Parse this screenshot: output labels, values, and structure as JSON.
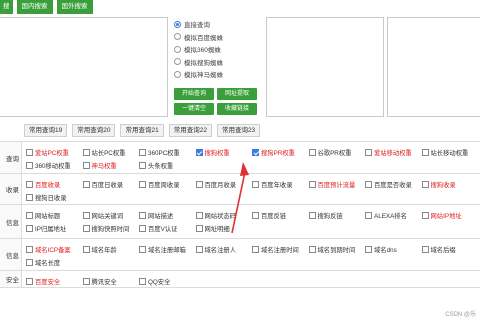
{
  "tabs": [
    "搜",
    "国内搜索",
    "国外搜索"
  ],
  "radios": [
    {
      "label": "直接查询",
      "checked": true
    },
    {
      "label": "模拟百度蜘蛛",
      "checked": false
    },
    {
      "label": "模拟360蜘蛛",
      "checked": false
    },
    {
      "label": "模拟搜狗蜘蛛",
      "checked": false
    },
    {
      "label": "模拟神马蜘蛛",
      "checked": false
    }
  ],
  "buttons": {
    "start": "开始查询",
    "extract": "网址提取",
    "clear": "一键清空",
    "export": "收藏链接"
  },
  "common_queries": [
    "常用查询19",
    "常用查询20",
    "常用查询21",
    "常用查询22",
    "常用查询23"
  ],
  "sections": [
    {
      "label": "查询",
      "items": [
        {
          "label": "爱站PC权重",
          "checked": false,
          "red": true
        },
        {
          "label": "站长PC权重",
          "checked": false,
          "red": false
        },
        {
          "label": "360PC权重",
          "checked": false,
          "red": false
        },
        {
          "label": "搜狗权重",
          "checked": true,
          "red": true
        },
        {
          "label": "搜狗PR权重",
          "checked": true,
          "red": true
        },
        {
          "label": "谷歌PR权重",
          "checked": false,
          "red": false
        },
        {
          "label": "爱站移动权重",
          "checked": false,
          "red": true
        },
        {
          "label": "站长移动权重",
          "checked": false,
          "red": false
        },
        {
          "label": "360移动权重",
          "checked": false,
          "red": false
        },
        {
          "label": "神马权重",
          "checked": false,
          "red": true
        },
        {
          "label": "头条权重",
          "checked": false,
          "red": false
        }
      ]
    },
    {
      "label": "收录",
      "items": [
        {
          "label": "百度收录",
          "checked": false,
          "red": true
        },
        {
          "label": "百度日收录",
          "checked": false,
          "red": false
        },
        {
          "label": "百度周收录",
          "checked": false,
          "red": false
        },
        {
          "label": "百度月收录",
          "checked": false,
          "red": false
        },
        {
          "label": "百度年收录",
          "checked": false,
          "red": false
        },
        {
          "label": "百度预计流量",
          "checked": false,
          "red": true
        },
        {
          "label": "百度是否收录",
          "checked": false,
          "red": false
        },
        {
          "label": "搜狗收录",
          "checked": false,
          "red": true
        },
        {
          "label": "搜狗日收录",
          "checked": false,
          "red": false
        }
      ]
    },
    {
      "label": "信息",
      "items": [
        {
          "label": "网站标题",
          "checked": false,
          "red": false
        },
        {
          "label": "网站关键词",
          "checked": false,
          "red": false
        },
        {
          "label": "网站描述",
          "checked": false,
          "red": false
        },
        {
          "label": "网站状态码",
          "checked": false,
          "red": false
        },
        {
          "label": "百度反链",
          "checked": false,
          "red": false
        },
        {
          "label": "搜狗反链",
          "checked": false,
          "red": false
        },
        {
          "label": "ALEXA排名",
          "checked": false,
          "red": false
        },
        {
          "label": "网站IP地址",
          "checked": false,
          "red": true
        },
        {
          "label": "IP归属地址",
          "checked": false,
          "red": false
        },
        {
          "label": "搜狗快照时间",
          "checked": false,
          "red": false
        },
        {
          "label": "百度V认证",
          "checked": false,
          "red": false
        },
        {
          "label": "网址明细",
          "checked": false,
          "red": false
        }
      ]
    },
    {
      "label": "信息",
      "items": [
        {
          "label": "域名ICP备案",
          "checked": false,
          "red": true
        },
        {
          "label": "域名年龄",
          "checked": false,
          "red": false
        },
        {
          "label": "域名注册邮箱",
          "checked": false,
          "red": false
        },
        {
          "label": "域名注册人",
          "checked": false,
          "red": false
        },
        {
          "label": "域名注册时间",
          "checked": false,
          "red": false
        },
        {
          "label": "域名到期时间",
          "checked": false,
          "red": false
        },
        {
          "label": "域名dns",
          "checked": false,
          "red": false
        },
        {
          "label": "域名后缀",
          "checked": false,
          "red": false
        },
        {
          "label": "域名长度",
          "checked": false,
          "red": false
        }
      ]
    },
    {
      "label": "安全",
      "items": [
        {
          "label": "百度安全",
          "checked": false,
          "red": true
        },
        {
          "label": "腾讯安全",
          "checked": false,
          "red": false
        },
        {
          "label": "QQ安全",
          "checked": false,
          "red": false
        }
      ]
    }
  ],
  "watermark": "CSDN @乐",
  "colors": {
    "green": "#3a9f3a",
    "red_text": "#dd2222",
    "checkbox_blue": "#3b7ddd",
    "arrow": "#e03030"
  }
}
